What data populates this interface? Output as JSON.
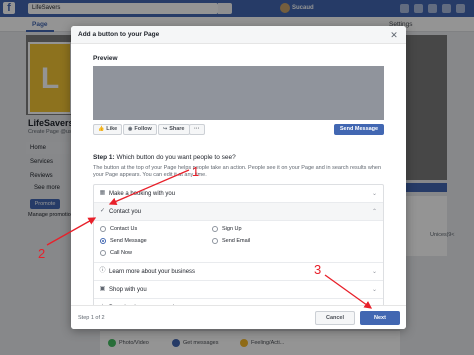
{
  "background": {
    "search_value": "LifeSavers",
    "user_name": "Sucaud",
    "tab_page": "Page",
    "tab_settings": "Settings",
    "page_name": "LifeSavers",
    "page_handle": "Create Page @username",
    "profile_letter": "L",
    "sidebar": [
      "Home",
      "Services",
      "Reviews",
      "See more"
    ],
    "promote_label": "Promote",
    "manage_label": "Manage promotions",
    "right_text": "Unices|9<",
    "composer": [
      "Photo/Video",
      "Get messages",
      "Feeling/Acti..."
    ]
  },
  "modal": {
    "title": "Add a button to your Page",
    "preview_label": "Preview",
    "preview_actions": [
      "Like",
      "Follow",
      "Share",
      "···"
    ],
    "preview_cta": "Send Message",
    "step_heading_prefix": "Step 1:",
    "step_heading_question": "Which button do you want people to see?",
    "step_description": "The button at the top of your Page helps people take an action. People see it on your Page and in search results when your Page appears. You can edit it at any time.",
    "options": [
      {
        "label": "Make a booking with you",
        "icon": "calendar-icon",
        "expanded": false
      },
      {
        "label": "Contact you",
        "icon": "check-icon",
        "expanded": true
      },
      {
        "label": "Learn more about your business",
        "icon": "info-icon",
        "expanded": false
      },
      {
        "label": "Shop with you",
        "icon": "shop-icon",
        "expanded": false
      },
      {
        "label": "Download your app or play your game",
        "icon": "download-icon",
        "expanded": false
      }
    ],
    "contact_choices": [
      {
        "label": "Contact Us",
        "selected": false
      },
      {
        "label": "Sign Up",
        "selected": false
      },
      {
        "label": "Send Message",
        "selected": true
      },
      {
        "label": "Send Email",
        "selected": false
      },
      {
        "label": "Call Now",
        "selected": false
      }
    ],
    "step_count": "Step 1 of 2",
    "cancel_label": "Cancel",
    "next_label": "Next"
  },
  "annotations": [
    "1",
    "2",
    "3"
  ],
  "colors": {
    "fb_blue": "#4267b2",
    "annotation_red": "#e8202a",
    "profile_yellow": "#f3c534"
  }
}
